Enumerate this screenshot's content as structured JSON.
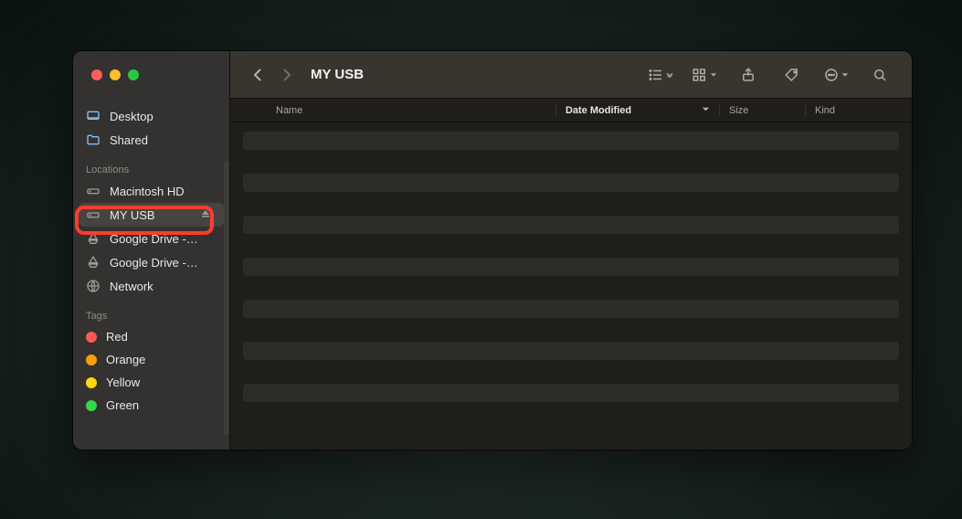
{
  "window": {
    "title": "MY USB"
  },
  "sidebar": {
    "favorites": [
      {
        "label": "Desktop",
        "icon": "desktop-icon"
      },
      {
        "label": "Shared",
        "icon": "folder-shared-icon"
      }
    ],
    "sections": {
      "locations_header": "Locations",
      "tags_header": "Tags"
    },
    "locations": [
      {
        "label": "Macintosh HD",
        "icon": "hdd-icon",
        "selected": false,
        "ejectable": false
      },
      {
        "label": "MY USB",
        "icon": "ext-disk-icon",
        "selected": true,
        "ejectable": true
      },
      {
        "label": "Google Drive -…",
        "icon": "cloud-icon",
        "selected": false,
        "ejectable": false
      },
      {
        "label": "Google Drive -…",
        "icon": "cloud-icon",
        "selected": false,
        "ejectable": false
      },
      {
        "label": "Network",
        "icon": "globe-icon",
        "selected": false,
        "ejectable": false
      }
    ],
    "tags": [
      {
        "label": "Red",
        "color": "#ff5a52"
      },
      {
        "label": "Orange",
        "color": "#ff9e0c"
      },
      {
        "label": "Yellow",
        "color": "#ffd70a"
      },
      {
        "label": "Green",
        "color": "#32d74b"
      }
    ]
  },
  "columns": {
    "name": "Name",
    "date_modified": "Date Modified",
    "size": "Size",
    "kind": "Kind"
  },
  "annotation": {
    "highlight_target": "sidebar-location-my-usb"
  }
}
